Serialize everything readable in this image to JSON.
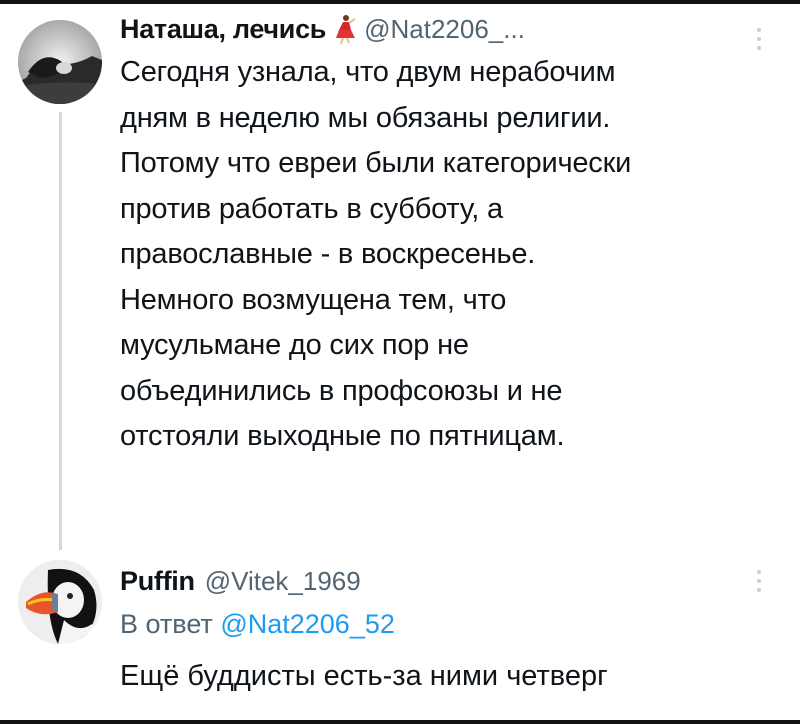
{
  "tweets": [
    {
      "display_name": "Наташа, лечись",
      "emoji_icon": "dancer-emoji",
      "handle": "@Nat2206_...",
      "lines": [
        "Сегодня узнала, что двум нерабочим",
        "дням в неделю мы обязаны религии.",
        "Потому что евреи были категорически",
        "против работать в субботу, а",
        "православные - в воскресенье.",
        "Немного возмущена тем, что",
        "мусульмане до сих пор не",
        "объединились в профсоюзы и не",
        "отстояли выходные по пятницам."
      ]
    },
    {
      "display_name": "Puffin",
      "handle": "@Vitek_1969",
      "reply_prefix": "В ответ ",
      "reply_mention": "@Nat2206_52",
      "text": "Ещё буддисты есть-за ними четверг"
    }
  ],
  "colors": {
    "text_primary": "#0f1419",
    "text_secondary": "#536471",
    "accent": "#1d9bf0",
    "thread_line": "#cfd9de"
  }
}
